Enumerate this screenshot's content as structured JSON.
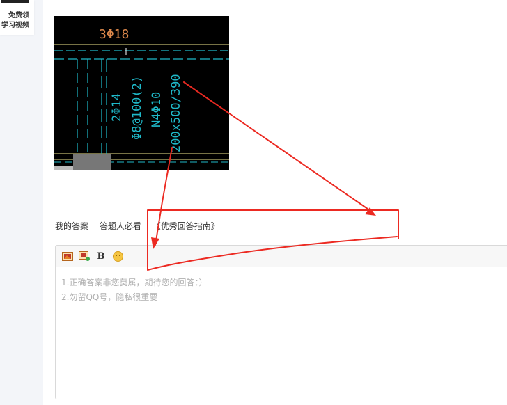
{
  "side_promo": {
    "line1": "免费领",
    "line2": "学习视频"
  },
  "cad_drawing": {
    "beam_top_bars": "3Φ18",
    "stirrup_note": "2Φ14",
    "stirrup_spacing": "Φ8@100(2)",
    "side_bars": "N4Φ10",
    "section_size": "200x500/390"
  },
  "answer_bar": {
    "my_answer": "我的答案",
    "must_read": "答题人必看",
    "guide_link": "《优秀回答指南》"
  },
  "editor": {
    "bold_label": "B",
    "placeholder_lines": [
      "1.正确答案非您莫属，期待您的回答：）",
      "2.勿留QQ号，隐私很重要"
    ]
  },
  "colors": {
    "cad_cyan": "#1fb9c9",
    "cad_orange": "#e08a4c",
    "cad_yellow": "#f0e68c",
    "annotation_red": "#ec2a22"
  }
}
